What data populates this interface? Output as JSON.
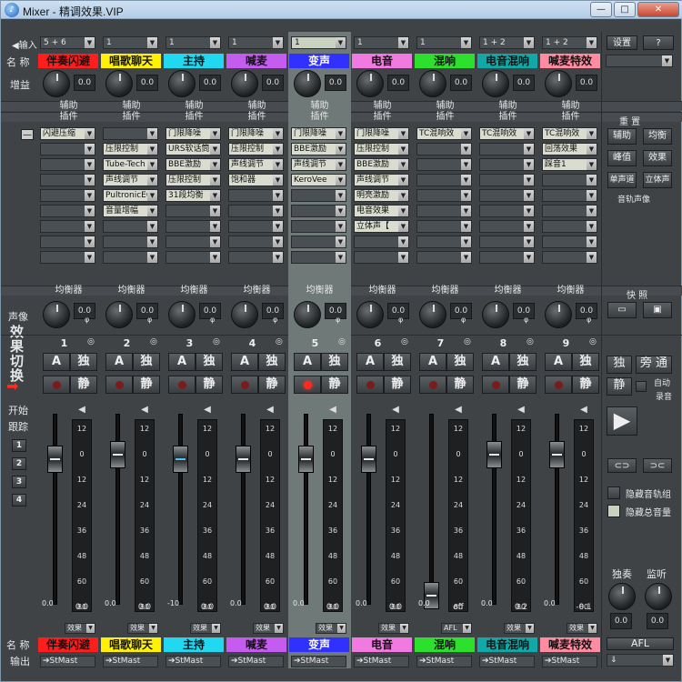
{
  "window": {
    "title": "Mixer - 精调效果.VIP",
    "icon": "mixer-app-icon",
    "controls": {
      "minimize": "—",
      "maximize": "□",
      "close": "✕"
    }
  },
  "row_labels": {
    "input": "◀输入",
    "name": "名 称",
    "gain": "增益",
    "pan": "声像",
    "effect_switch": "效果切换",
    "start": "开始",
    "follow": "跟踪",
    "name_bottom": "名 称",
    "output": "输出"
  },
  "channels": [
    {
      "num": "1",
      "name": "伴奏闪避",
      "color": "#ff1e1e",
      "input": "5 + 6",
      "gain": "0.0",
      "pan": "0.0",
      "inserts": [
        "闪避压缩"
      ],
      "meter_val": "0.0",
      "fader_bottom": "0.0",
      "efx": "效果",
      "out": "➔StMast"
    },
    {
      "num": "2",
      "name": "唱歌聊天",
      "color": "#fff200",
      "input": "1",
      "gain": "0.0",
      "pan": "0.0",
      "inserts": [
        "",
        "压限控制",
        "Tube-Tech",
        "声线调节",
        "PultronicEQ",
        "音量增幅"
      ],
      "meter_val": "0.0",
      "fader_bottom": "0.0",
      "efx": "效果",
      "out": "➔StMast"
    },
    {
      "num": "3",
      "name": "主持",
      "color": "#22d8f0",
      "input": "1",
      "gain": "0.0",
      "pan": "0.0",
      "inserts": [
        "门限降噪",
        "URS软话筒",
        "BBE激励",
        "压限控制",
        "31段均衡"
      ],
      "meter_val": "0.0",
      "fader_bottom": "-10",
      "efx": "效果",
      "out": "➔StMast"
    },
    {
      "num": "4",
      "name": "喊麦",
      "color": "#c45cf0",
      "input": "1",
      "gain": "0.0",
      "pan": "0.0",
      "inserts": [
        "门限降噪",
        "压限控制",
        "声线调节",
        "饱和器"
      ],
      "meter_val": "0.0",
      "fader_bottom": "0.0",
      "efx": "效果",
      "out": "➔StMast"
    },
    {
      "num": "5",
      "name": "变声",
      "color": "#3030ff",
      "input": "1",
      "gain": "0.0",
      "pan": "0.0",
      "inserts": [
        "门限降噪",
        "BBE激励",
        "声线调节",
        "KeroVee"
      ],
      "meter_val": "0.0",
      "fader_bottom": "0.0",
      "efx": "效果",
      "out": "➔StMast"
    },
    {
      "num": "6",
      "name": "电音",
      "color": "#f07ae0",
      "input": "1",
      "gain": "0.0",
      "pan": "0.0",
      "inserts": [
        "门限降噪",
        "压限控制",
        "BBE激励",
        "声线调节",
        "明亮激励",
        "电音效果",
        "立体声【"
      ],
      "meter_val": "0.0",
      "fader_bottom": "0.0",
      "efx": "效果",
      "out": "➔StMast"
    },
    {
      "num": "7",
      "name": "混响",
      "color": "#2ee02e",
      "input": "1",
      "gain": "0.0",
      "pan": "0.0",
      "inserts": [
        "TC混响效"
      ],
      "meter_val": "off",
      "fader_bottom": "0.0",
      "efx": "AFL",
      "out": "➔StMast"
    },
    {
      "num": "8",
      "name": "电音混响",
      "color": "#12a8a8",
      "input": "1 + 2",
      "gain": "0.0",
      "pan": "0.0",
      "inserts": [
        "TC混响效"
      ],
      "meter_val": "0.2",
      "fader_bottom": "0.0",
      "efx": "效果",
      "out": "➔StMast"
    },
    {
      "num": "9",
      "name": "喊麦特效",
      "color": "#ff8ca0",
      "input": "1 + 2",
      "gain": "0.0",
      "pan": "0.0",
      "inserts": [
        "TC混响效",
        "回荡效果",
        "踩音1"
      ],
      "meter_val": "-0.1",
      "fader_bottom": "0.0",
      "efx": "效果",
      "out": "➔StMast"
    }
  ],
  "strip": {
    "aux": "辅助",
    "plugins": "插件",
    "eq": "均衡器",
    "solo": "独",
    "mute": "静",
    "A": "A",
    "scale": [
      "12",
      "0",
      "12",
      "24",
      "36",
      "48",
      "60",
      "80"
    ]
  },
  "right": {
    "settings": "设置",
    "help": "?",
    "reset": "重 置",
    "aux": "辅助",
    "eq": "均衡",
    "peak": "峰值",
    "effect": "效果",
    "mono": "单声道",
    "stereo": "立体声",
    "track_pan": "音轨声像",
    "snapshot": "快 照",
    "solo": "独",
    "bypass": "旁 通",
    "mute": "静",
    "auto": "自动",
    "record": "录音",
    "hide_groups": "隐藏音轨组",
    "hide_master": "隐藏总音量",
    "solo_label": "独奏",
    "monitor_label": "监听",
    "afl": "AFL",
    "out_sel": "⇓"
  },
  "follow_nums": [
    "1",
    "2",
    "3",
    "4"
  ]
}
